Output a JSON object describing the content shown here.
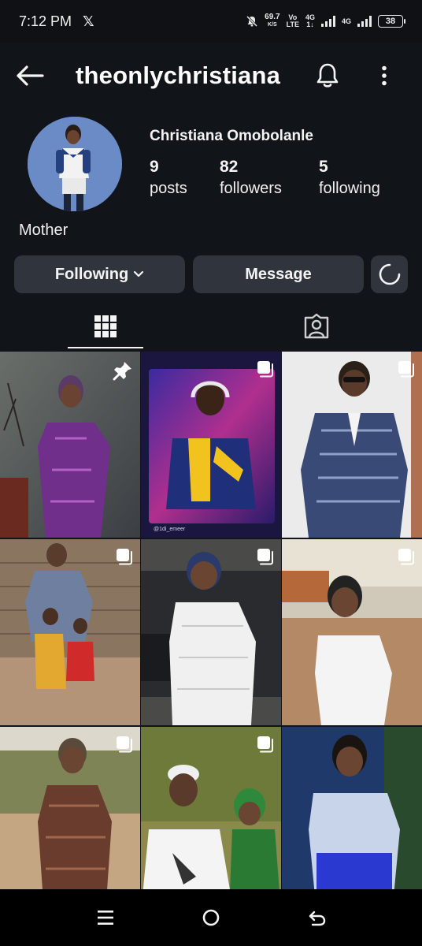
{
  "status_bar": {
    "time": "7:12 PM",
    "x_logo": "𝕏",
    "speed_value": "69.7",
    "speed_unit": "K/S",
    "vo_lte_top": "Vo",
    "vo_lte_bottom": "LTE",
    "network_1": "4G",
    "network_1_sub": "1↓",
    "network_2": "4G",
    "battery": "38",
    "icons": [
      "mute-icon",
      "signal-icon",
      "battery-icon"
    ]
  },
  "header": {
    "username": "theonlychristiana",
    "icons": [
      "back-arrow-icon",
      "bell-icon",
      "more-vertical-icon"
    ]
  },
  "profile": {
    "display_name": "Christiana Omobolanle",
    "stats": [
      {
        "value": "9",
        "label": "posts"
      },
      {
        "value": "82",
        "label": "followers"
      },
      {
        "value": "5",
        "label": "following"
      }
    ],
    "bio": "Mother"
  },
  "actions": {
    "following_label": "Following",
    "message_label": "Message"
  },
  "tabs": [
    {
      "icon": "grid-icon",
      "selected": true
    },
    {
      "icon": "tagged-icon",
      "selected": false
    }
  ],
  "posts": [
    {
      "type": "pinned",
      "icon": "pin-icon"
    },
    {
      "type": "carousel",
      "icon": "carousel-icon",
      "caption": "@1di_emeer"
    },
    {
      "type": "carousel",
      "icon": "carousel-icon"
    },
    {
      "type": "carousel",
      "icon": "carousel-icon"
    },
    {
      "type": "carousel",
      "icon": "carousel-icon"
    },
    {
      "type": "carousel",
      "icon": "carousel-icon"
    },
    {
      "type": "carousel",
      "icon": "carousel-icon"
    },
    {
      "type": "carousel",
      "icon": "carousel-icon"
    },
    {
      "type": "photo"
    }
  ],
  "nav": {
    "icons": [
      "menu-icon",
      "home-icon",
      "back-icon"
    ]
  },
  "colors": {
    "background": "#111418",
    "button": "#30353d",
    "text": "#f4f4f4"
  }
}
